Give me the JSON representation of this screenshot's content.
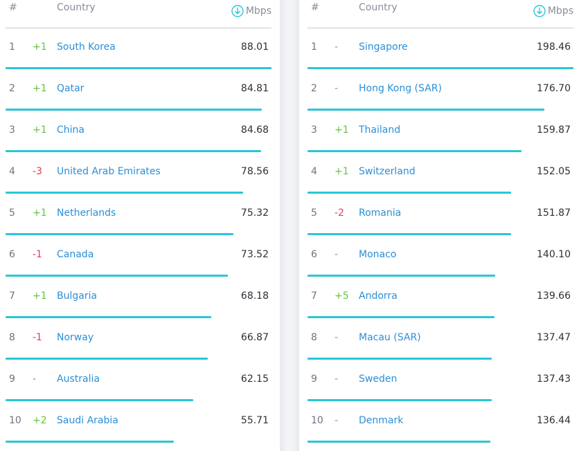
{
  "headers": {
    "rank": "#",
    "country": "Country",
    "unit": "Mbps"
  },
  "colors": {
    "bar": "#29c6d6",
    "country_link": "#2a8fd6",
    "rank_up": "#63c43f",
    "rank_down": "#ea3a59",
    "rank_same": "#8a8d99"
  },
  "icons": {
    "unit": "download-arrow-circle-icon"
  },
  "left": {
    "rows": [
      {
        "rank": "1",
        "change": "+1",
        "trend": "up",
        "country": "South Korea",
        "speed": "88.01",
        "bar_fraction": 1.0
      },
      {
        "rank": "2",
        "change": "+1",
        "trend": "up",
        "country": "Qatar",
        "speed": "84.81",
        "bar_fraction": 0.9636
      },
      {
        "rank": "3",
        "change": "+1",
        "trend": "up",
        "country": "China",
        "speed": "84.68",
        "bar_fraction": 0.9622
      },
      {
        "rank": "4",
        "change": "-3",
        "trend": "down",
        "country": "United Arab Emirates",
        "speed": "78.56",
        "bar_fraction": 0.8926
      },
      {
        "rank": "5",
        "change": "+1",
        "trend": "up",
        "country": "Netherlands",
        "speed": "75.32",
        "bar_fraction": 0.8558
      },
      {
        "rank": "6",
        "change": "-1",
        "trend": "down",
        "country": "Canada",
        "speed": "73.52",
        "bar_fraction": 0.8354
      },
      {
        "rank": "7",
        "change": "+1",
        "trend": "up",
        "country": "Bulgaria",
        "speed": "68.18",
        "bar_fraction": 0.7747
      },
      {
        "rank": "8",
        "change": "-1",
        "trend": "down",
        "country": "Norway",
        "speed": "66.87",
        "bar_fraction": 0.7598
      },
      {
        "rank": "9",
        "change": "-",
        "trend": "same",
        "country": "Australia",
        "speed": "62.15",
        "bar_fraction": 0.7062
      },
      {
        "rank": "10",
        "change": "+2",
        "trend": "up",
        "country": "Saudi Arabia",
        "speed": "55.71",
        "bar_fraction": 0.633
      }
    ]
  },
  "right": {
    "rows": [
      {
        "rank": "1",
        "change": "-",
        "trend": "same",
        "country": "Singapore",
        "speed": "198.46",
        "bar_fraction": 1.0
      },
      {
        "rank": "2",
        "change": "-",
        "trend": "same",
        "country": "Hong Kong (SAR)",
        "speed": "176.70",
        "bar_fraction": 0.8904
      },
      {
        "rank": "3",
        "change": "+1",
        "trend": "up",
        "country": "Thailand",
        "speed": "159.87",
        "bar_fraction": 0.8055
      },
      {
        "rank": "4",
        "change": "+1",
        "trend": "up",
        "country": "Switzerland",
        "speed": "152.05",
        "bar_fraction": 0.7661
      },
      {
        "rank": "5",
        "change": "-2",
        "trend": "down",
        "country": "Romania",
        "speed": "151.87",
        "bar_fraction": 0.7652
      },
      {
        "rank": "6",
        "change": "-",
        "trend": "same",
        "country": "Monaco",
        "speed": "140.10",
        "bar_fraction": 0.7059
      },
      {
        "rank": "7",
        "change": "+5",
        "trend": "up",
        "country": "Andorra",
        "speed": "139.66",
        "bar_fraction": 0.7037
      },
      {
        "rank": "8",
        "change": "-",
        "trend": "same",
        "country": "Macau (SAR)",
        "speed": "137.47",
        "bar_fraction": 0.6927
      },
      {
        "rank": "9",
        "change": "-",
        "trend": "same",
        "country": "Sweden",
        "speed": "137.43",
        "bar_fraction": 0.6925
      },
      {
        "rank": "10",
        "change": "-",
        "trend": "same",
        "country": "Denmark",
        "speed": "136.44",
        "bar_fraction": 0.6875
      }
    ]
  }
}
